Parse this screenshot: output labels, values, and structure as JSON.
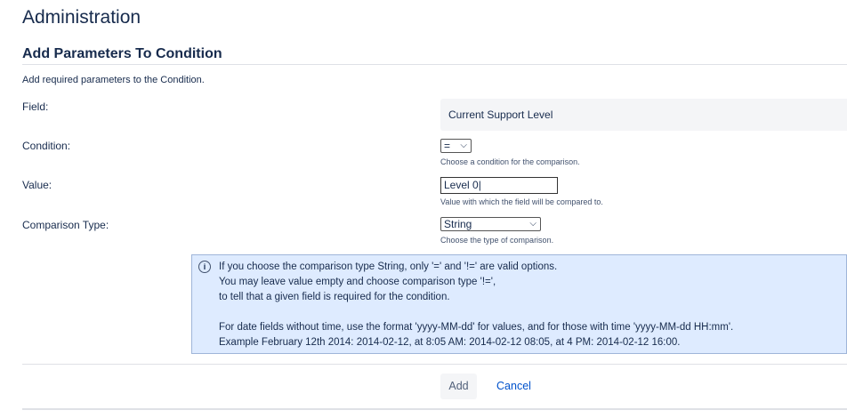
{
  "page_title": "Administration",
  "section_title": "Add Parameters To Condition",
  "description": "Add required parameters to the Condition.",
  "field": {
    "label": "Field:",
    "value": "Current Support Level"
  },
  "condition": {
    "label": "Condition:",
    "selected": "=",
    "hint": "Choose a condition for the comparison."
  },
  "value": {
    "label": "Value:",
    "current": "Level 0",
    "hint": "Value with which the field will be compared to."
  },
  "comparison_type": {
    "label": "Comparison Type:",
    "selected": "String",
    "hint": "Choose the type of comparison."
  },
  "info": {
    "lines": [
      "If you choose the comparison type String, only '=' and '!=' are valid options.",
      "You may leave value empty and choose comparison type '!=',",
      "to tell that a given field is required for the condition.",
      "For date fields without time, use the format 'yyyy-MM-dd' for values, and for those with time 'yyyy-MM-dd HH:mm'.",
      "Example February 12th 2014: 2014-02-12, at 8:05 AM: 2014-02-12 08:05, at 4 PM: 2014-02-12 16:00."
    ]
  },
  "buttons": {
    "add": "Add",
    "cancel": "Cancel"
  }
}
